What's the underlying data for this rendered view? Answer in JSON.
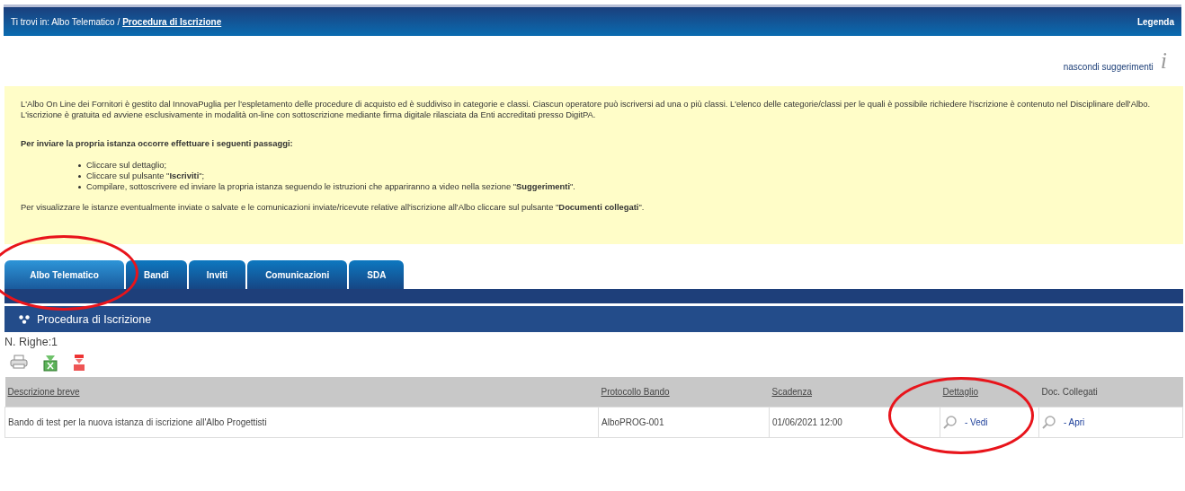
{
  "header": {
    "breadcrumb_prefix": "Ti trovi in: Albo Telematico /",
    "breadcrumb_current": "Procedura di Iscrizione",
    "legend_link": "Legenda"
  },
  "tips": {
    "toggle_link": "nascondi suggerimenti",
    "info_icon": "i",
    "paragraphs": [
      "L'Albo On Line dei Fornitori è gestito dal InnovaPuglia per l'espletamento delle procedure di acquisto ed è suddiviso in categorie e classi. Ciascun operatore può iscriversi ad una o più classi. L'elenco delle categorie/classi per le quali è possibile richiedere l'iscrizione è contenuto nel Disciplinare dell'Albo.",
      "L'iscrizione è gratuita ed avviene esclusivamente in modalità on-line con sottoscrizione mediante firma digitale rilasciata da Enti accreditati presso DigitPA."
    ],
    "steps_heading": "Per inviare la propria istanza occorre effettuare i seguenti passaggi:",
    "steps": [
      "Cliccare sul dettaglio;",
      "Cliccare sul pulsante \"**Iscriviti**\";",
      "Compilare, sottoscrivere ed inviare la propria istanza seguendo le istruzioni che appariranno a video nella sezione \"**Suggerimenti**\"."
    ],
    "footer": "Per visualizzare le istanze eventualmente inviate o salvate e le comunicazioni inviate/ricevute relative all'iscrizione all'Albo cliccare sul pulsante \"**Documenti collegati**\"."
  },
  "tabs": [
    {
      "label": "Albo Telematico",
      "selected": true
    },
    {
      "label": "Bandi",
      "selected": false
    },
    {
      "label": "Inviti",
      "selected": false
    },
    {
      "label": "Comunicazioni",
      "selected": false
    },
    {
      "label": "SDA",
      "selected": false
    }
  ],
  "section": {
    "title": "Procedura di Iscrizione",
    "expanded": true
  },
  "row_count": "N. Righe:1",
  "table": {
    "columns": [
      {
        "label": "Descrizione breve",
        "sortable": true
      },
      {
        "label": "Protocollo Bando",
        "sortable": true
      },
      {
        "label": "Scadenza",
        "sortable": true
      },
      {
        "label": "Dettaglio",
        "sortable": true
      },
      {
        "label": "Doc. Collegati",
        "sortable": false
      }
    ],
    "rows": [
      [
        {
          "kind": "text",
          "text": "Bando di test per la nuova istanza di iscrizione all'Albo Progettisti"
        },
        {
          "kind": "text",
          "text": "AlboPROG-001"
        },
        {
          "kind": "text",
          "text": "01/06/2021 12:00"
        },
        {
          "kind": "link",
          "text": "- Vedi"
        },
        {
          "kind": "link",
          "text": "- Apri"
        }
      ]
    ]
  }
}
